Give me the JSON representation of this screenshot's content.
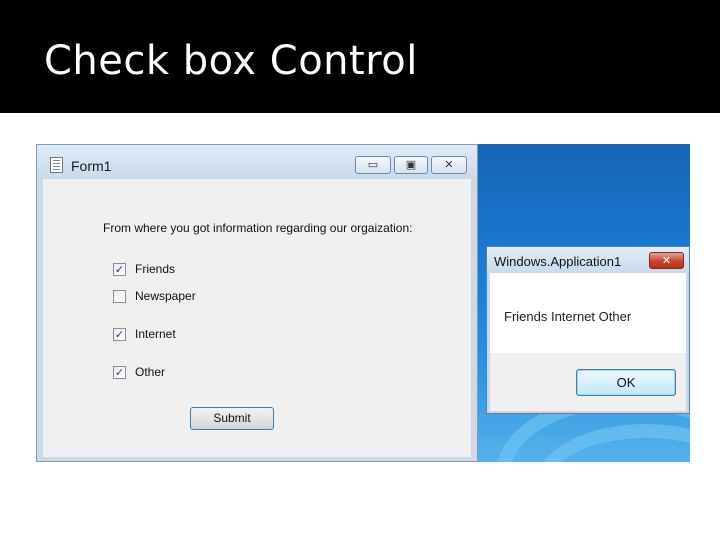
{
  "slide": {
    "title": "Check box Control"
  },
  "form": {
    "title": "Form1",
    "caption_buttons": {
      "minimize": "▭",
      "maximize": "▣",
      "close": "✕"
    },
    "question": "From where you got information regarding our orgaization:",
    "checkboxes": [
      {
        "label": "Friends",
        "checked": true,
        "glyph": "✓"
      },
      {
        "label": "Newspaper",
        "checked": false,
        "glyph": ""
      },
      {
        "label": "Internet",
        "checked": true,
        "glyph": "✓"
      },
      {
        "label": "Other",
        "checked": true,
        "glyph": "✓"
      }
    ],
    "submit_label": "Submit"
  },
  "message_box": {
    "title": "Windows.Application1",
    "close_glyph": "✕",
    "text": "Friends Internet Other",
    "ok_label": "OK"
  }
}
